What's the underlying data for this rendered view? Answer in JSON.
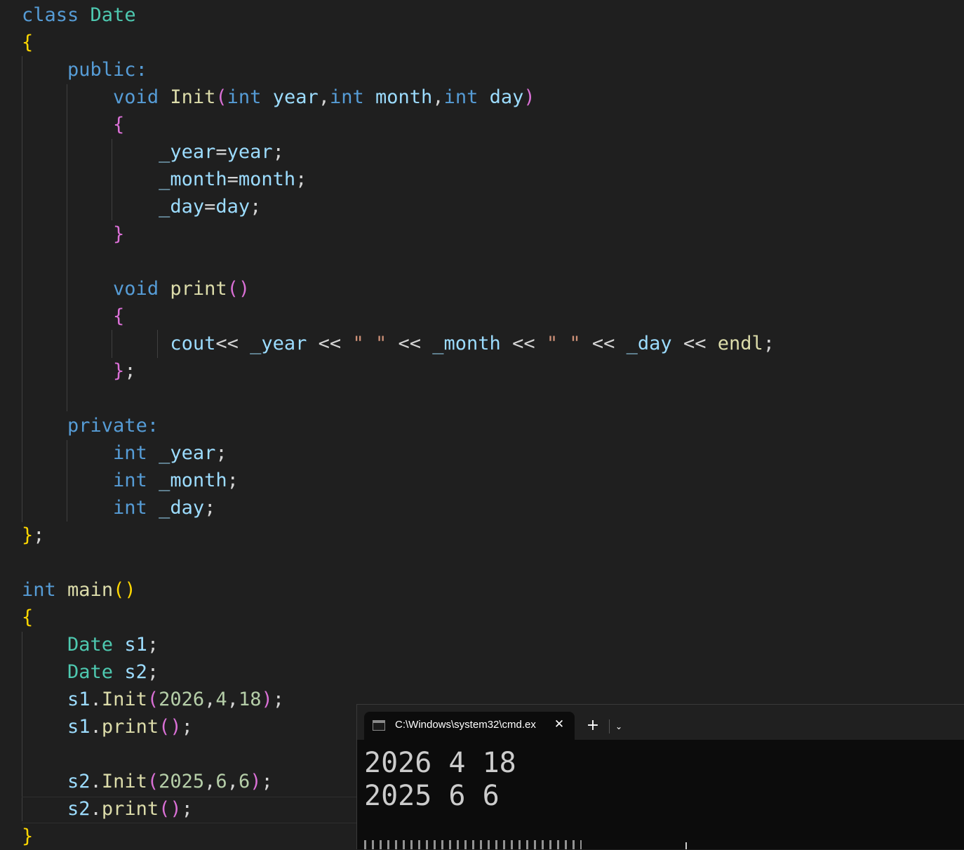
{
  "code": {
    "class_kw": "class",
    "class_name": "Date",
    "public_label": "public:",
    "private_label": "private:",
    "void_kw": "void",
    "int_kw": "int",
    "init_name": "Init",
    "print_name": "print",
    "param_year": "year",
    "param_month": "month",
    "param_day": "day",
    "field_year": "_year",
    "field_month": "_month",
    "field_day": "_day",
    "cout": "cout",
    "endl": "endl",
    "space_str": "\" \"",
    "main_name": "main",
    "obj1": "s1",
    "obj2": "s2",
    "call1_args": [
      "2026",
      "4",
      "18"
    ],
    "call2_args": [
      "2025",
      "6",
      "6"
    ]
  },
  "terminal": {
    "tab_title": "C:\\Windows\\system32\\cmd.ex",
    "tab_icon": "cmd-icon",
    "close_icon": "close-icon",
    "new_tab_icon": "plus-icon",
    "dropdown_icon": "chevron-down-icon",
    "output": [
      "2026 4 18",
      "2025 6 6"
    ]
  }
}
